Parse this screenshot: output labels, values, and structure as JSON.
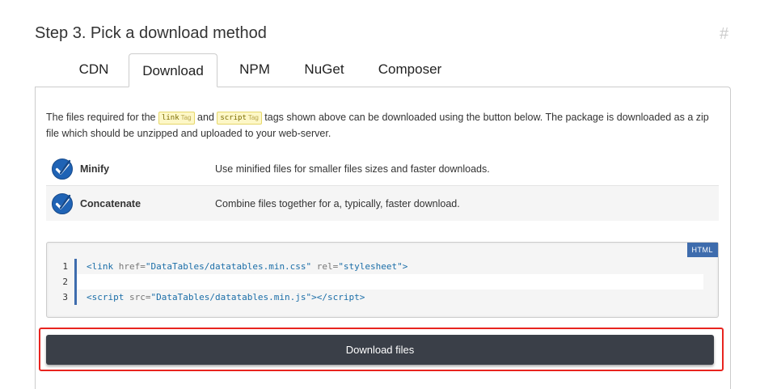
{
  "header": {
    "title": "Step 3. Pick a download method",
    "anchor": "#"
  },
  "tabs": [
    {
      "label": "CDN",
      "active": false
    },
    {
      "label": "Download",
      "active": true
    },
    {
      "label": "NPM",
      "active": false
    },
    {
      "label": "NuGet",
      "active": false
    },
    {
      "label": "Composer",
      "active": false
    }
  ],
  "description": {
    "part1": "The files required for the ",
    "tag1": "link",
    "tag_word": "Tag",
    "part2": " and ",
    "tag2": "script",
    "part3": " tags shown above can be downloaded using the button below. The package is downloaded as a zip file which should be unzipped and uploaded to your web-server."
  },
  "options": [
    {
      "name": "Minify",
      "description": "Use minified files for smaller files sizes and faster downloads.",
      "checked": true,
      "icon": "check-circle-icon"
    },
    {
      "name": "Concatenate",
      "description": "Combine files together for a, typically, faster download.",
      "checked": true,
      "icon": "check-circle-icon"
    }
  ],
  "code": {
    "language": "HTML",
    "lines": [
      {
        "number": "1",
        "tag_open": "<link",
        "attr1": " href=",
        "val1": "\"DataTables/datatables.min.css\"",
        "attr2": " rel=",
        "val2": "\"stylesheet\"",
        "tag_close": ">"
      },
      {
        "number": "2"
      },
      {
        "number": "3",
        "tag_open": "<script",
        "attr1": " src=",
        "val1": "\"DataTables/datatables.min.js\"",
        "tag_mid": "></",
        "tag_end": "script",
        "tag_close": ">"
      }
    ]
  },
  "download_button": {
    "label": "Download files"
  },
  "colors": {
    "accent": "#3e6cad",
    "button": "#3a3f48",
    "highlight": "#e8241f",
    "check": "#1f63b5"
  }
}
